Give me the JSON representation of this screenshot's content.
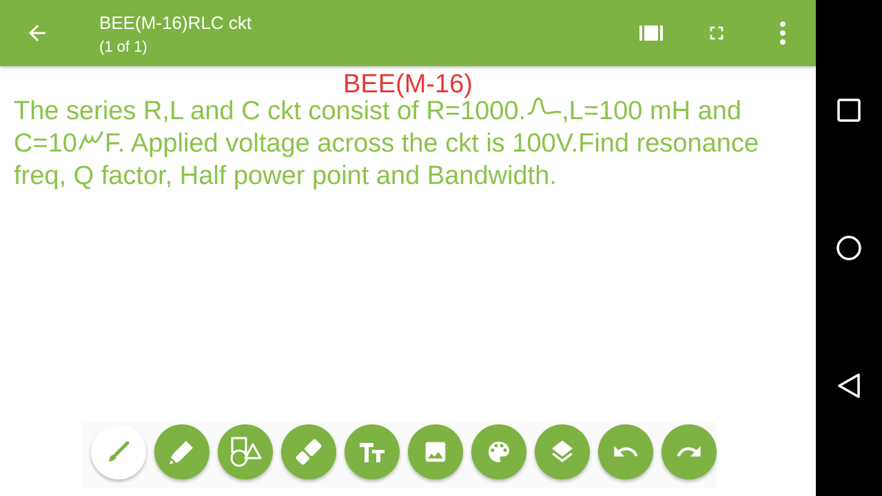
{
  "appbar": {
    "title": "BEE(M-16)RLC ckt",
    "subtitle": "(1 of 1)",
    "icons": [
      "back-arrow-icon",
      "page-view-icon",
      "fullscreen-icon",
      "more-vert-icon"
    ]
  },
  "note": {
    "heading": "BEE(M-16)",
    "line1_a": "The series R,L and C ckt consist of R=1000.",
    "line1_b": ",L=100 mH and",
    "line2_a": "C=10",
    "line2_b": "F. Applied voltage across the ckt is 100V.Find resonance",
    "line3": "freq, Q factor, Half power point and Bandwidth."
  },
  "toolbar": {
    "tools": [
      "brush-icon",
      "highlighter-icon",
      "shapes-icon",
      "eraser-icon",
      "text-icon",
      "image-icon",
      "palette-icon",
      "layers-icon",
      "undo-icon",
      "redo-icon"
    ],
    "selected": "brush-icon"
  },
  "navbar": {
    "icons": [
      "recents-square-icon",
      "home-circle-icon",
      "back-triangle-icon"
    ]
  },
  "colors": {
    "accent": "#7cb342",
    "note_text": "#8bc34a",
    "heading_text": "#e53935"
  }
}
